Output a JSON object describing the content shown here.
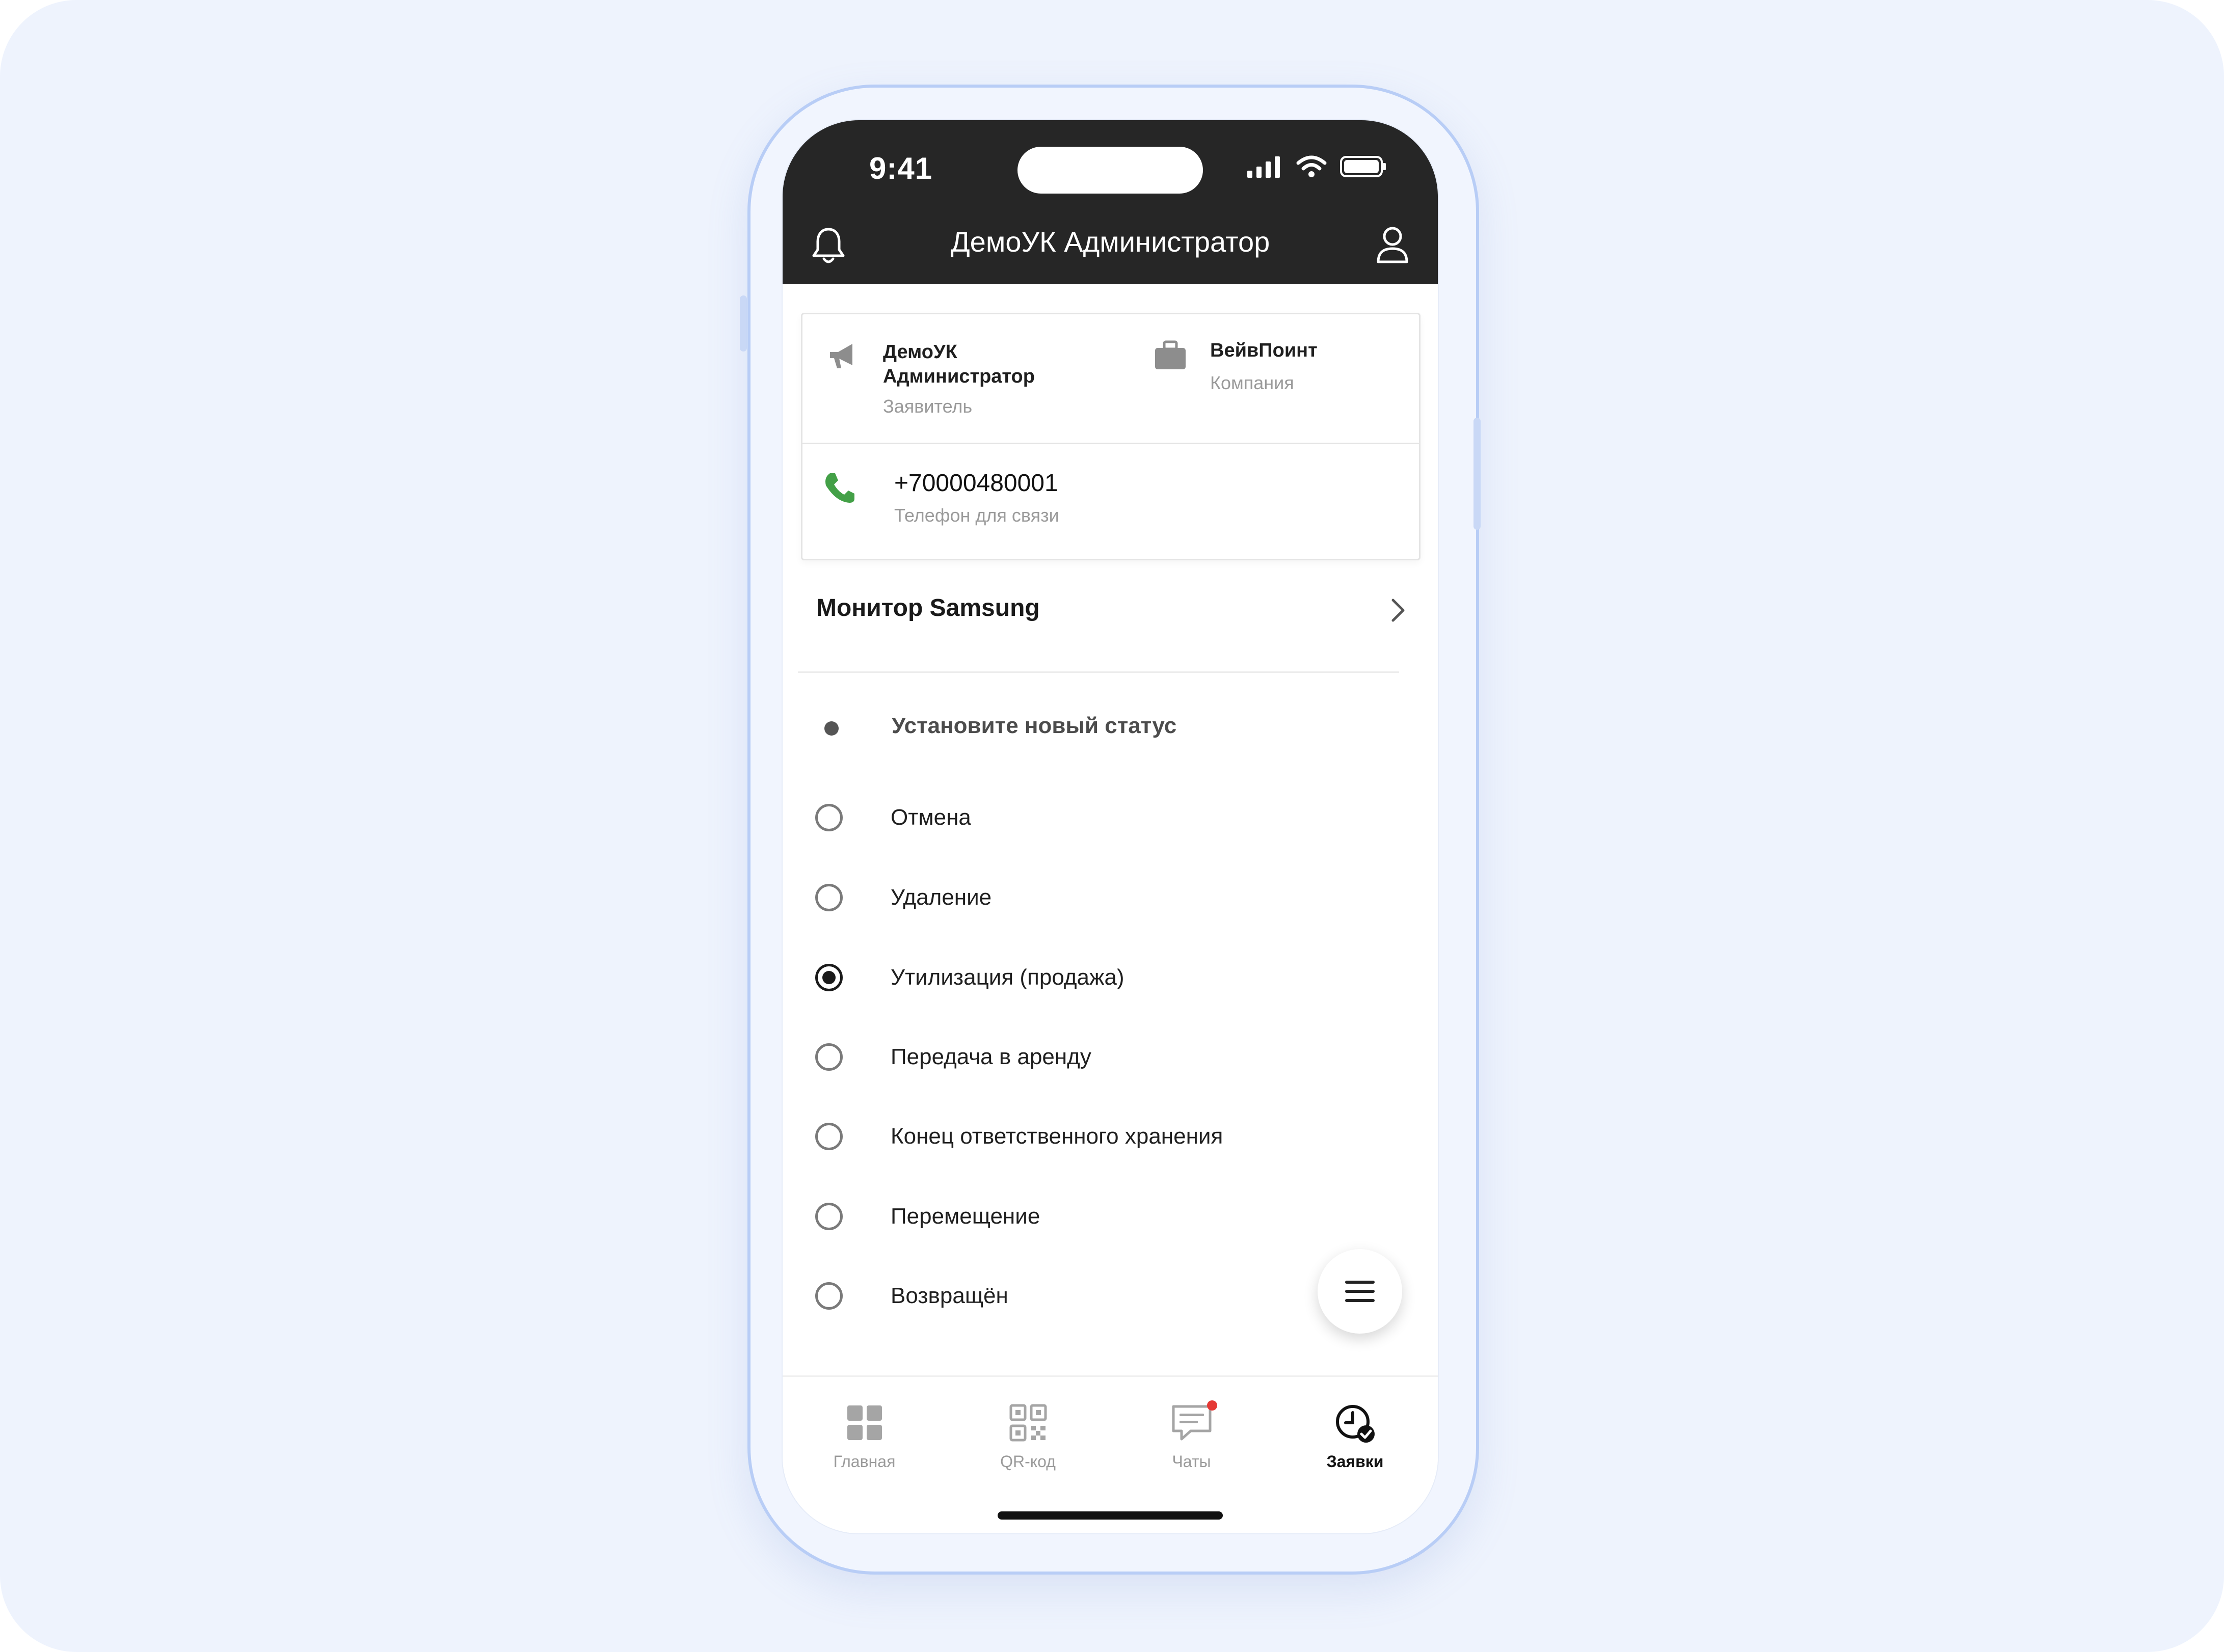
{
  "status_bar": {
    "time": "9:41",
    "icons": [
      "cellular-signal-icon",
      "wifi-icon",
      "battery-icon"
    ]
  },
  "header": {
    "title": "ДемоУК Администратор",
    "left_icon": "bell-icon",
    "right_icon": "user-icon"
  },
  "info_card": {
    "applicant_name": "ДемоУК Администратор",
    "applicant_role": "Заявитель",
    "company_name": "ВейвПоинт",
    "company_role": "Компания",
    "phone_number": "+70000480001",
    "phone_label": "Телефон для связи"
  },
  "device": {
    "name": "Монитор Samsung"
  },
  "status": {
    "heading": "Установите новый статус",
    "options": [
      {
        "label": "Отмена",
        "selected": false
      },
      {
        "label": "Удаление",
        "selected": false
      },
      {
        "label": "Утилизация (продажа)",
        "selected": true
      },
      {
        "label": "Передача в аренду",
        "selected": false
      },
      {
        "label": "Конец ответственного хранения",
        "selected": false
      },
      {
        "label": "Перемещение",
        "selected": false
      },
      {
        "label": "Возвращён",
        "selected": false
      }
    ]
  },
  "fab": {
    "icon": "menu-icon"
  },
  "bottom_nav": {
    "items": [
      {
        "label": "Главная",
        "icon": "grid-icon",
        "active": false
      },
      {
        "label": "QR-код",
        "icon": "qr-code-icon",
        "active": false
      },
      {
        "label": "Чаты",
        "icon": "chat-icon",
        "active": false,
        "badge": true
      },
      {
        "label": "Заявки",
        "icon": "requests-clock-icon",
        "active": true
      }
    ]
  },
  "colors": {
    "header_bg": "#262626",
    "phone_icon": "#43a047",
    "badge": "#e53935",
    "background": "#eef3fd"
  }
}
